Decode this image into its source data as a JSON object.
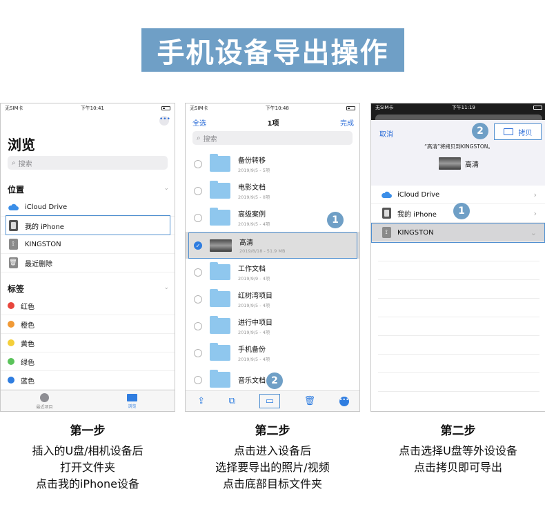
{
  "banner": {
    "title": "手机设备导出操作"
  },
  "phone1": {
    "status": {
      "carrier": "无SIM卡",
      "time": "下午10:41"
    },
    "title": "浏览",
    "search_placeholder": "搜索",
    "locations_header": "位置",
    "locations": [
      "iCloud Drive",
      "我的 iPhone",
      "KINGSTON",
      "最近删除"
    ],
    "tags_header": "标签",
    "tags": [
      {
        "label": "红色",
        "color": "#e8463d"
      },
      {
        "label": "橙色",
        "color": "#f19a36"
      },
      {
        "label": "黄色",
        "color": "#f4cf3a"
      },
      {
        "label": "绿色",
        "color": "#5bc35b"
      },
      {
        "label": "蓝色",
        "color": "#2f7de0"
      }
    ],
    "tabs": [
      "最近项目",
      "浏览"
    ]
  },
  "phone2": {
    "status": {
      "carrier": "无SIM卡",
      "time": "下午10:48"
    },
    "select_all": "全选",
    "count": "1项",
    "done": "完成",
    "search_placeholder": "搜索",
    "files": [
      {
        "name": "备份转移",
        "meta": "2019/9/5 - 5项",
        "selected": false,
        "type": "folder"
      },
      {
        "name": "电影文档",
        "meta": "2019/9/5 - 0项",
        "selected": false,
        "type": "folder"
      },
      {
        "name": "高级案例",
        "meta": "2019/9/5 - 4项",
        "selected": false,
        "type": "folder"
      },
      {
        "name": "高清",
        "meta": "2019/8/18 - 51.9 MB",
        "selected": true,
        "type": "video"
      },
      {
        "name": "工作文档",
        "meta": "2019/9/9 - 4项",
        "selected": false,
        "type": "folder"
      },
      {
        "name": "红树湾项目",
        "meta": "2019/9/5 - 4项",
        "selected": false,
        "type": "folder"
      },
      {
        "name": "进行中项目",
        "meta": "2019/9/5 - 4项",
        "selected": false,
        "type": "folder"
      },
      {
        "name": "手机备份",
        "meta": "2019/9/5 - 4项",
        "selected": false,
        "type": "folder"
      },
      {
        "name": "音乐文档",
        "meta": "",
        "selected": false,
        "type": "folder"
      }
    ],
    "badge1": "1",
    "badge2": "2"
  },
  "phone3": {
    "status": {
      "carrier": "无SIM卡",
      "time": "下午11:19"
    },
    "cancel": "取消",
    "copy": "拷贝",
    "caption": "“高清”将拷贝到KINGSTON。",
    "file_name": "高清",
    "locations": [
      "iCloud Drive",
      "我的 iPhone",
      "KINGSTON"
    ],
    "badge1": "1",
    "badge2": "2"
  },
  "steps": [
    {
      "title": "第一步",
      "lines": [
        "插入的U盘/相机设备后",
        "打开文件夹",
        "点击我的iPhone设备"
      ]
    },
    {
      "title": "第二步",
      "lines": [
        "点击进入设备后",
        "选择要导出的照片/视频",
        "点击底部目标文件夹"
      ]
    },
    {
      "title": "第二步",
      "lines": [
        "点击选择U盘等外设设备",
        "点击拷贝即可导出"
      ]
    }
  ]
}
